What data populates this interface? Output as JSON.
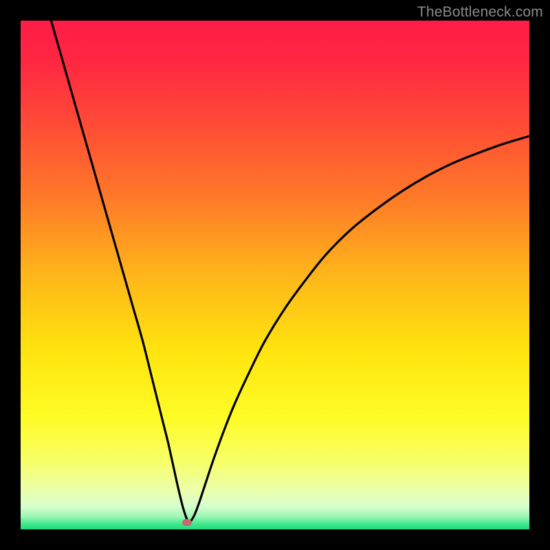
{
  "attribution": "TheBottleneck.com",
  "colors": {
    "black": "#000000",
    "curve": "#000000",
    "gradient_stops": [
      {
        "offset": 0.0,
        "color": "#ff1c46"
      },
      {
        "offset": 0.08,
        "color": "#ff2742"
      },
      {
        "offset": 0.2,
        "color": "#ff4a36"
      },
      {
        "offset": 0.35,
        "color": "#ff7a28"
      },
      {
        "offset": 0.5,
        "color": "#ffb61a"
      },
      {
        "offset": 0.65,
        "color": "#ffe40f"
      },
      {
        "offset": 0.78,
        "color": "#fffc26"
      },
      {
        "offset": 0.86,
        "color": "#f8ff62"
      },
      {
        "offset": 0.92,
        "color": "#ecffa6"
      },
      {
        "offset": 0.955,
        "color": "#d6ffce"
      },
      {
        "offset": 0.975,
        "color": "#9cf7b4"
      },
      {
        "offset": 0.99,
        "color": "#3fe88c"
      },
      {
        "offset": 1.0,
        "color": "#1fdc7e"
      }
    ],
    "marker": "#c46a6a"
  },
  "chart_data": {
    "type": "line",
    "title": "",
    "xlabel": "",
    "ylabel": "",
    "xlim": [
      0,
      100
    ],
    "ylim": [
      0,
      100
    ],
    "grid": false,
    "legend_position": "none",
    "series": [
      {
        "name": "bottleneck-curve",
        "x": [
          6,
          8,
          10,
          12,
          14,
          16,
          18,
          20,
          22,
          24,
          26,
          28,
          29,
          30,
          31,
          32,
          33,
          34,
          35,
          36,
          38,
          40,
          42,
          45,
          48,
          52,
          56,
          60,
          65,
          70,
          75,
          80,
          85,
          90,
          95,
          100
        ],
        "y": [
          100,
          93,
          86,
          79,
          72,
          65,
          58,
          51,
          44,
          37,
          29,
          21,
          17,
          12.5,
          8,
          4,
          1.5,
          2.5,
          5,
          8,
          14,
          19.5,
          24.5,
          31,
          37,
          43.5,
          49,
          54,
          59,
          63,
          66.5,
          69.5,
          72,
          74,
          75.8,
          77.3
        ]
      }
    ],
    "annotations": [
      {
        "name": "minimum-marker",
        "x": 32.7,
        "y": 1.3
      }
    ]
  }
}
